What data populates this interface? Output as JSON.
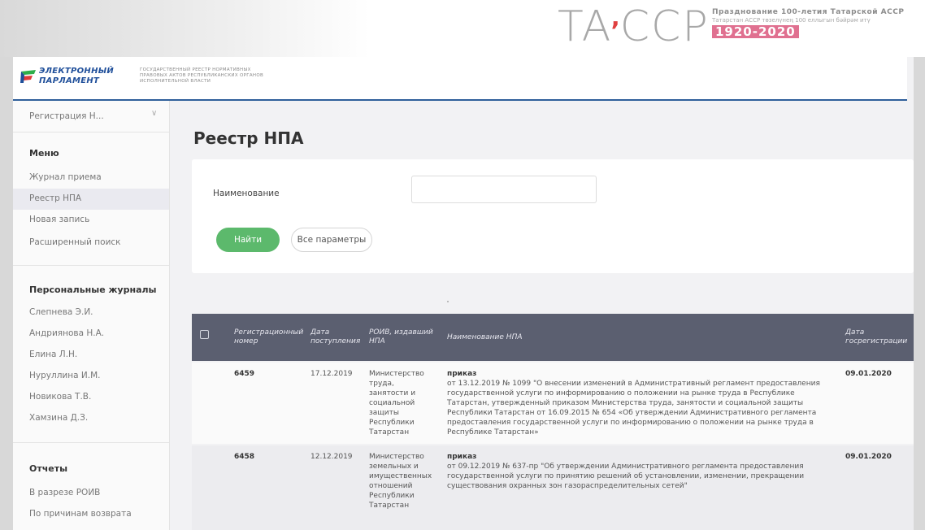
{
  "banner": {
    "logo_left": "TA",
    "logo_accent": "’",
    "logo_right": "CCP",
    "line1": "Празднование 100-летия Татарской АССР",
    "line2": "Татарстан АССР төзелүнең 100 еллыгын бәйрәм итү",
    "years": "1920-2020"
  },
  "header": {
    "brand_line1": "ЭЛЕКТРОННЫЙ",
    "brand_line2": "ПАРЛАМЕНТ",
    "subtitle": "ГОСУДАРСТВЕННЫЙ РЕЕСТР НОРМАТИВНЫХ ПРАВОВЫХ АКТОВ РЕСПУБЛИКАНСКИХ ОРГАНОВ ИСПОЛНИТЕЛЬНОЙ ВЛАСТИ"
  },
  "sidebar": {
    "select_value": "Регистрация Н...",
    "menu_title": "Меню",
    "menu_items": [
      "Журнал приема",
      "Реестр НПА",
      "Новая запись",
      "Расширенный поиск"
    ],
    "journals_title": "Персональные журналы",
    "journals": [
      "Слепнева Э.И.",
      "Андриянова Н.А.",
      "Елина Л.Н.",
      "Нуруллина И.М.",
      "Новикова Т.В.",
      "Хамзина Д.З."
    ],
    "reports_title": "Отчеты",
    "reports": [
      "В разрезе РОИВ",
      "По причинам возврата"
    ]
  },
  "main": {
    "title": "Реестр НПА",
    "filter_label": "Наименование",
    "filter_value": "",
    "find_button": "Найти",
    "all_params_button": "Все параметры"
  },
  "table": {
    "columns": [
      "Регистрационный номер",
      "Дата поступления",
      "РОИВ, издавший НПА",
      "Наименование НПА",
      "Дата госрегистрации"
    ],
    "rows": [
      {
        "reg_no": "6459",
        "date_in": "17.12.2019",
        "roiv": "Министерство труда, занятости и социальной защиты Республики Татарстан",
        "doc_type": "приказ",
        "name": "от 13.12.2019 № 1099 \"О внесении изменений в Административный регламент предоставления государственной услуги по информированию о положении на рынке труда в Республике Татарстан, утвержденный приказом Министерства труда, занятости и социальной защиты Республики Татарстан от 16.09.2015 № 654 «Об утверждении Административного регламента предоставления государственной услуги по информированию о положении на рынке труда в Республике Татарстан»",
        "reg_date": "09.01.2020"
      },
      {
        "reg_no": "6458",
        "date_in": "12.12.2019",
        "roiv": "Министерство земельных и имущественных отношений Республики Татарстан",
        "doc_type": "приказ",
        "name": "от 09.12.2019 № 637-пр \"Об утверждении Административного регламента предоставления государственной услуги по принятию решений об установлении, изменении, прекращении существования охранных зон газораспределительных сетей\"",
        "reg_date": "09.01.2020"
      }
    ]
  }
}
